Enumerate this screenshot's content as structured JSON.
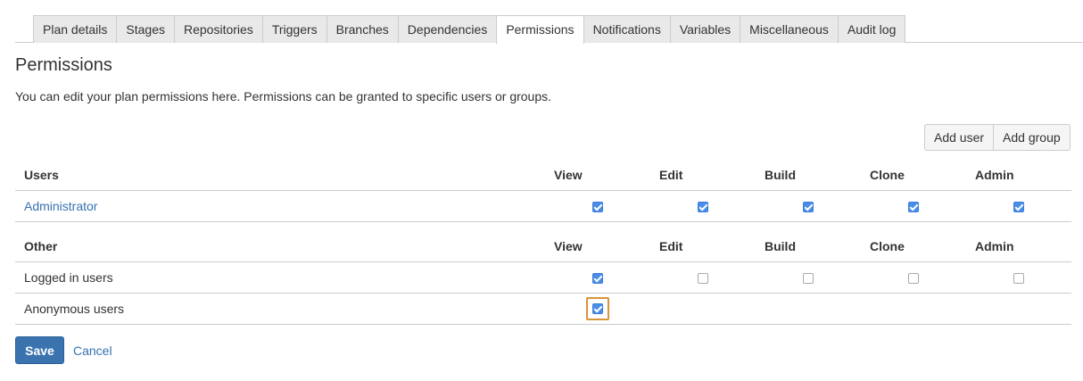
{
  "tabs": [
    {
      "label": "Plan details",
      "active": false
    },
    {
      "label": "Stages",
      "active": false
    },
    {
      "label": "Repositories",
      "active": false
    },
    {
      "label": "Triggers",
      "active": false
    },
    {
      "label": "Branches",
      "active": false
    },
    {
      "label": "Dependencies",
      "active": false
    },
    {
      "label": "Permissions",
      "active": true
    },
    {
      "label": "Notifications",
      "active": false
    },
    {
      "label": "Variables",
      "active": false
    },
    {
      "label": "Miscellaneous",
      "active": false
    },
    {
      "label": "Audit log",
      "active": false
    }
  ],
  "page": {
    "title": "Permissions",
    "description": "You can edit your plan permissions here. Permissions can be granted to specific users or groups."
  },
  "actions": {
    "add_user": "Add user",
    "add_group": "Add group"
  },
  "permission_columns": [
    "View",
    "Edit",
    "Build",
    "Clone",
    "Admin"
  ],
  "users_section": {
    "header": "Users",
    "rows": [
      {
        "name": "Administrator",
        "link": true,
        "perms": [
          true,
          true,
          true,
          true,
          true
        ]
      }
    ]
  },
  "other_section": {
    "header": "Other",
    "rows": [
      {
        "name": "Logged in users",
        "link": false,
        "perms": [
          true,
          false,
          false,
          false,
          false
        ]
      },
      {
        "name": "Anonymous users",
        "link": false,
        "perms": [
          true
        ]
      }
    ]
  },
  "form": {
    "save_label": "Save",
    "cancel_label": "Cancel"
  },
  "colors": {
    "accent": "#3b73af",
    "link": "#3572b0",
    "checkbox_checked": "#4a8ee8",
    "focus_highlight": "#d9943a"
  }
}
